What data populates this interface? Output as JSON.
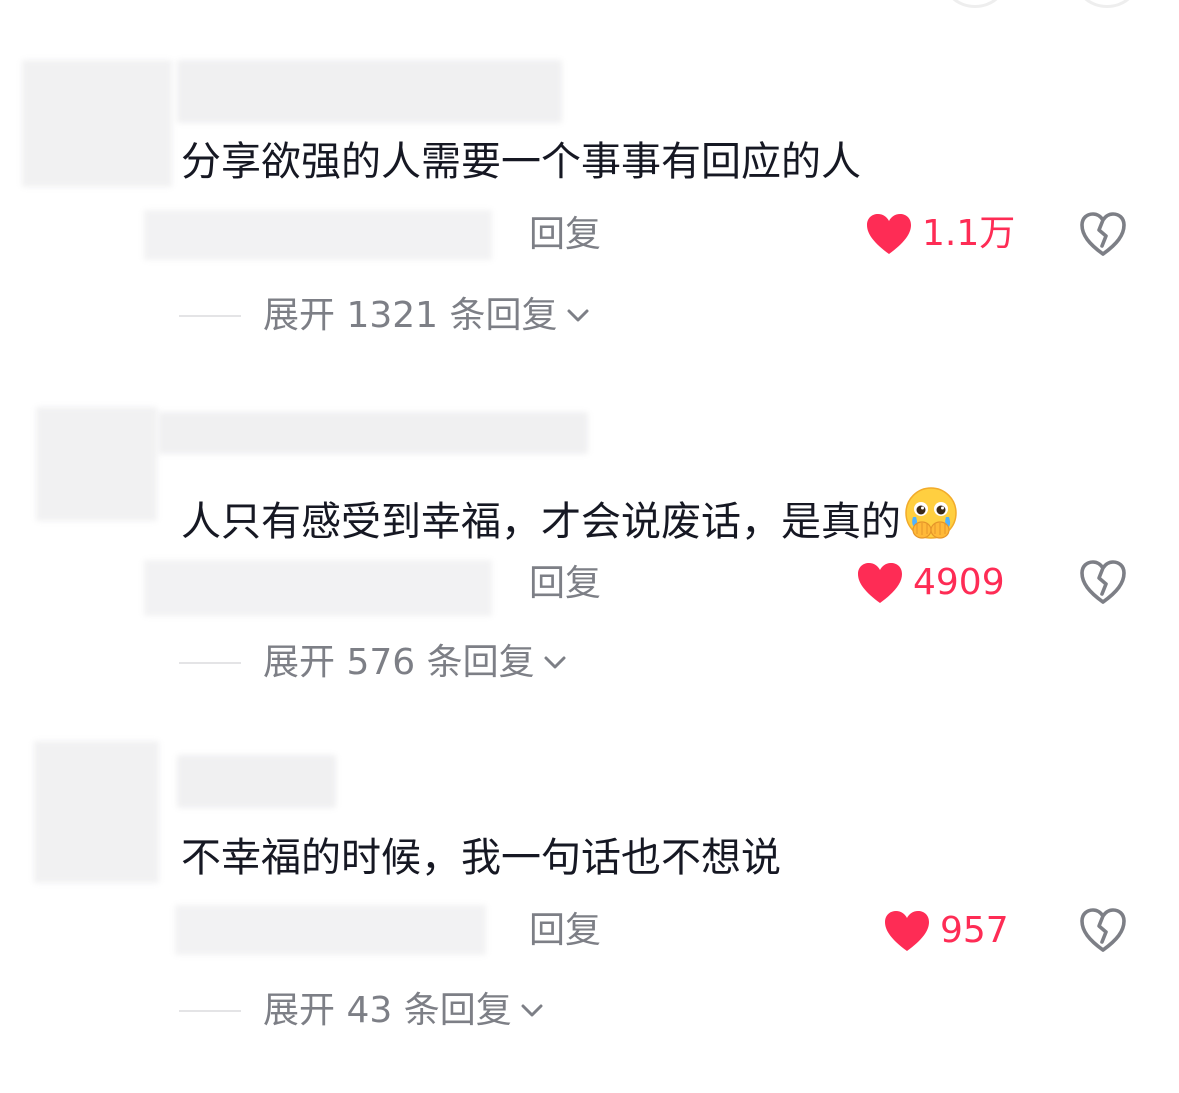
{
  "comments": [
    {
      "text": "分享欲强的人需要一个事事有回应的人",
      "reply_label": "回复",
      "likes": "1.1万",
      "expand_label": "展开 1321 条回复",
      "has_emoji": false
    },
    {
      "text": "人只有感受到幸福，才会说废话，是真的",
      "reply_label": "回复",
      "likes": "4909",
      "expand_label": "展开 576 条回复",
      "has_emoji": true,
      "emoji": "crying-face-emoji"
    },
    {
      "text": "不幸福的时候，我一句话也不想说",
      "reply_label": "回复",
      "likes": "957",
      "expand_label": "展开 43 条回复",
      "has_emoji": false
    }
  ],
  "colors": {
    "like": "#fe2c55",
    "text": "#161823",
    "secondary": "#7d7f86"
  }
}
